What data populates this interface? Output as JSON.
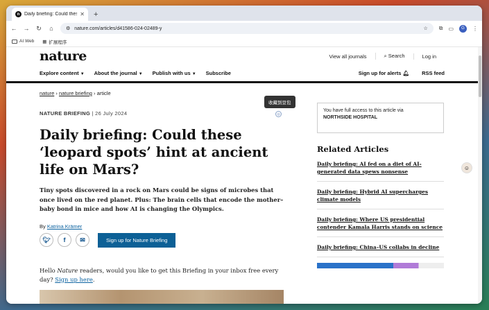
{
  "browser": {
    "tab_title": "Daily briefing: Could these 'le",
    "tab_favicon": "n",
    "url": "nature.com/articles/d41586-024-02489-y",
    "bookmarks": [
      "AI Web",
      "扩展程序"
    ],
    "profile_initial": "G"
  },
  "site": {
    "logo": "nature",
    "view_all_journals": "View all journals",
    "search": "Search",
    "login": "Log in",
    "nav": {
      "explore": "Explore content",
      "about": "About the journal",
      "publish": "Publish with us",
      "subscribe": "Subscribe",
      "alerts": "Sign up for alerts",
      "rss": "RSS feed"
    }
  },
  "article": {
    "breadcrumb": [
      "nature",
      "nature briefing",
      "article"
    ],
    "type": "NATURE BRIEFING",
    "date": "26 July 2024",
    "headline": "Daily briefing: Could these ‘leopard spots’ hint at ancient life on Mars?",
    "standfirst": "Tiny spots discovered in a rock on Mars could be signs of microbes that once lived on the red planet. Plus: The brain cells that encode the mother–baby bond in mice and how AI is changing the Olympics.",
    "byline_prefix": "By",
    "author": "Katrina Krämer",
    "signup_button": "Sign up for Nature Briefing",
    "intro_pre": "Hello ",
    "intro_em": "Nature",
    "intro_mid": " readers, would you like to get this Briefing in your inbox free every day? ",
    "intro_link": "Sign up here",
    "intro_end": "."
  },
  "sidebar": {
    "access_text": "You have full access to this article via",
    "access_institution": "NORTHSIDE HOSPITAL",
    "related_title": "Related Articles",
    "related": [
      "Daily briefing: AI fed on a diet of AI-generated data spews nonsense",
      "Daily briefing: Hybrid AI supercharges climate models",
      "Daily briefing: Where US presidential contender Kamala Harris stands on science",
      "Daily briefing: China–US collabs in decline"
    ]
  },
  "tooltip": "收藏到豆包"
}
